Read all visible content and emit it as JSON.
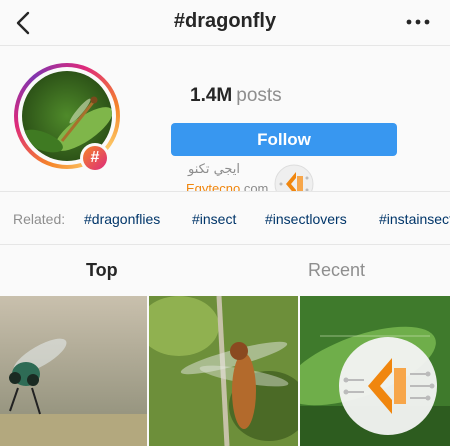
{
  "nav": {
    "title": "#dragonfly",
    "back_icon": "chevron-left-icon",
    "more_icon": "more-horizontal-icon"
  },
  "profile": {
    "posts_count": "1.4M",
    "posts_label": "posts",
    "follow_label": "Follow",
    "badge_symbol": "#"
  },
  "watermark": {
    "arabic": "ايجي تكنو",
    "brand_colored": "Egytecno",
    "brand_suffix": ".com"
  },
  "related": {
    "label": "Related:",
    "tags": [
      "#dragonflies",
      "#insect",
      "#insectlovers",
      "#instainsects"
    ]
  },
  "tabs": {
    "top": "Top",
    "recent": "Recent"
  },
  "colors": {
    "follow_blue": "#3897f0",
    "tag_blue": "#003569",
    "ring_start": "#f58529",
    "ring_end": "#dd2a7b",
    "watermark_orange": "#f0860e"
  }
}
